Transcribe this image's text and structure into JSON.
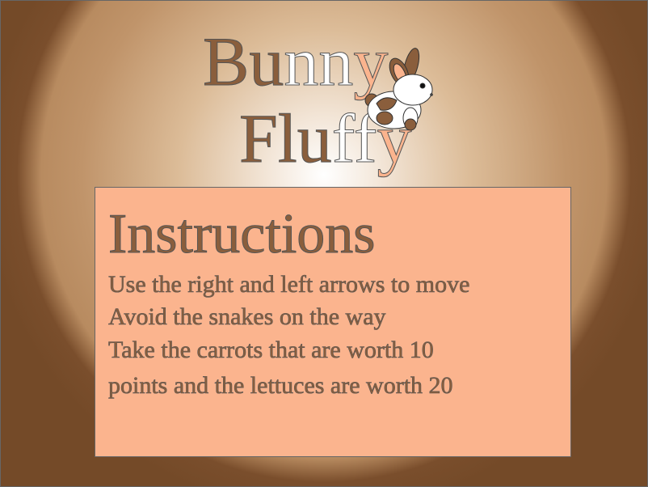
{
  "title": {
    "line1": {
      "part1": "Bu",
      "part2": "nn",
      "part3": "y"
    },
    "line2": {
      "part1": "Flu",
      "part2": "ff",
      "part3": "y"
    }
  },
  "instructions": {
    "heading": "Instructions",
    "lines": [
      "Use the right and left arrows to move",
      "Avoid the snakes on the way",
      "Take the carrots that are worth 10",
      "points and the lettuces are worth 20"
    ]
  },
  "colors": {
    "background_edge": "#744a28",
    "panel": "#fbb48e",
    "text_brown": "#8a5e3c"
  },
  "icons": {
    "mascot": "bunny-icon"
  }
}
